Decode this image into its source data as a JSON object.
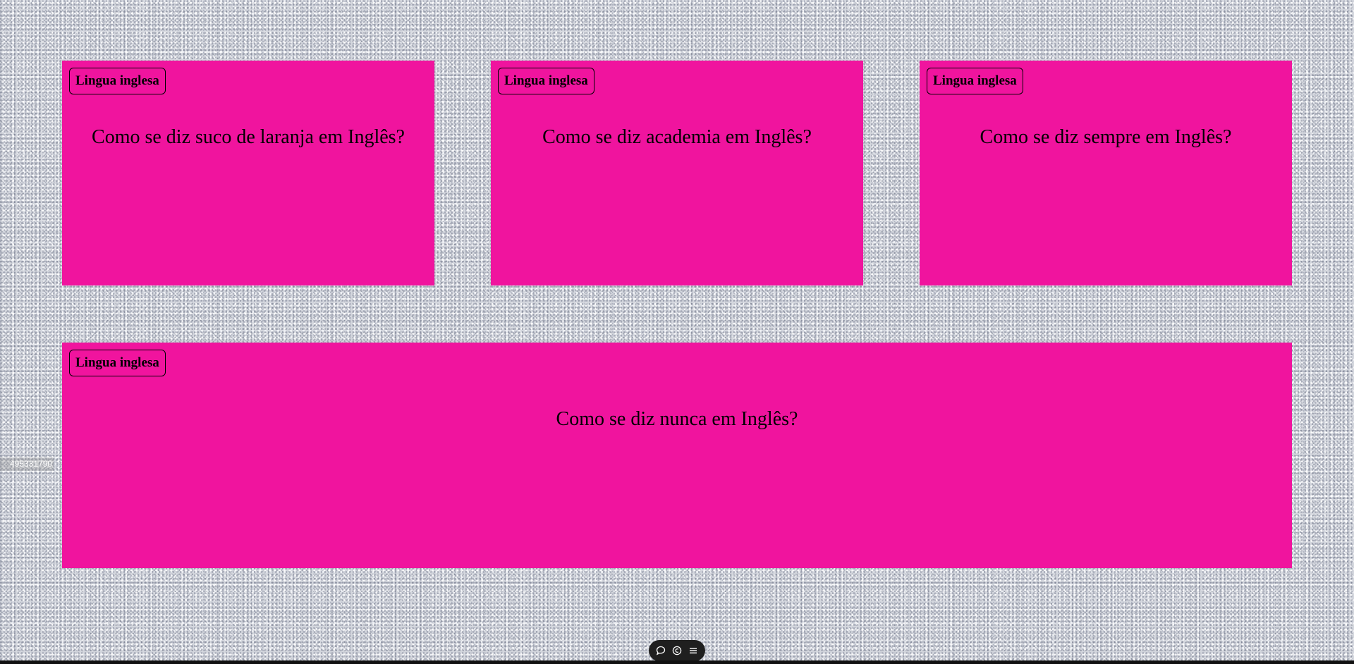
{
  "cards": [
    {
      "tag": "Lingua inglesa",
      "question": "Como se diz suco de laranja em Inglês?"
    },
    {
      "tag": "Lingua inglesa",
      "question": "Como se diz academia em Inglês?"
    },
    {
      "tag": "Lingua inglesa",
      "question": "Como se diz sempre em Inglês?"
    },
    {
      "tag": "Lingua inglesa",
      "question": "Como se diz nunca em Inglês?"
    }
  ],
  "side_id": "495331790",
  "toolbar": {
    "icons": [
      "comment-icon",
      "copyright-icon",
      "menu-icon"
    ]
  },
  "colors": {
    "card_background": "#f0149e",
    "toolbar_background": "#1f1f1f"
  }
}
